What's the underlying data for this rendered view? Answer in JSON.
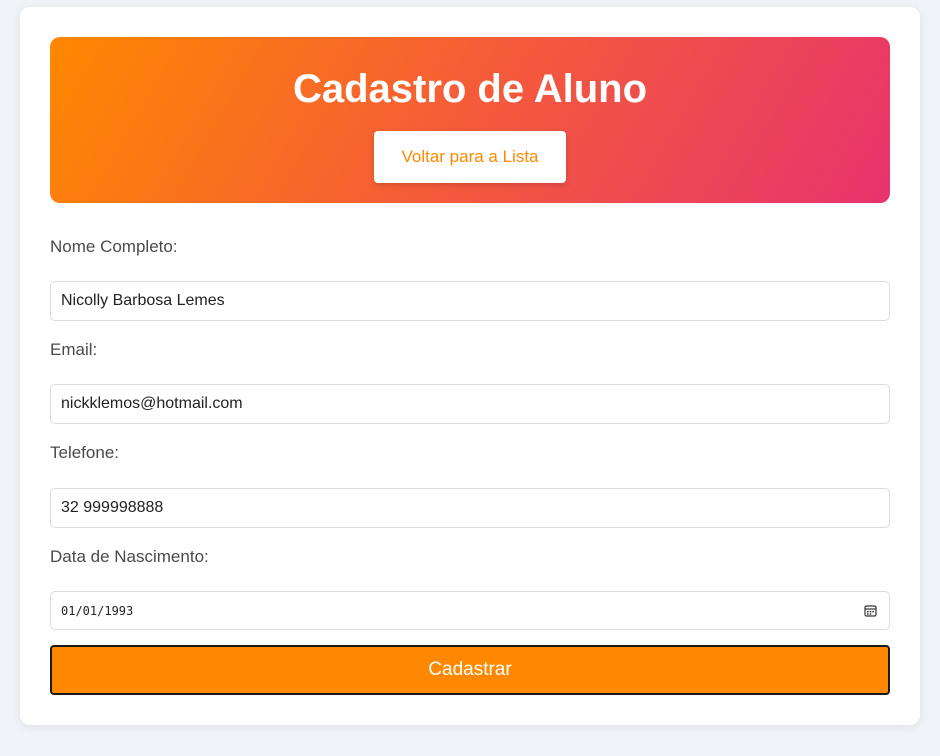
{
  "header": {
    "title": "Cadastro de Aluno",
    "back_button_label": "Voltar para a Lista"
  },
  "form": {
    "name_label": "Nome Completo:",
    "name_value": "Nicolly Barbosa Lemes",
    "email_label": "Email:",
    "email_value": "nickklemos@hotmail.com",
    "phone_label": "Telefone:",
    "phone_value": "32 999998888",
    "birth_label": "Data de Nascimento:",
    "birth_value": "01/01/1993",
    "submit_label": "Cadastrar"
  },
  "colors": {
    "accent": "#ff8800",
    "gradient_end": "#e8336e"
  },
  "icons": {
    "date_picker": "calendar-icon"
  }
}
